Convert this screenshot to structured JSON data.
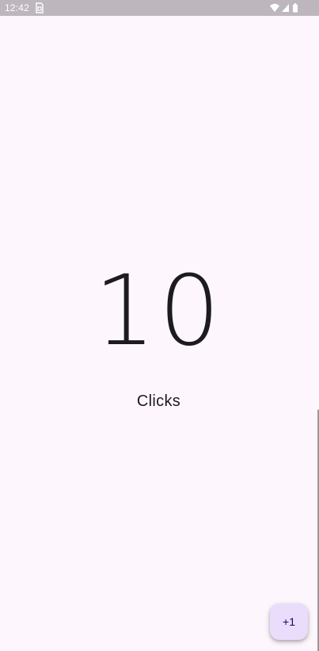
{
  "status_bar": {
    "time": "12:42",
    "icons": [
      "sim-card-icon",
      "wifi-icon",
      "cellular-signal-icon",
      "battery-icon"
    ]
  },
  "counter": {
    "value": "10",
    "label": "Clicks"
  },
  "fab": {
    "label": "+1"
  },
  "colors": {
    "background": "#fdf7fd",
    "status_bar": "#bdb7bd",
    "text": "#1d1b20",
    "fab_container": "#e9ddfb",
    "fab_content": "#21005d"
  }
}
